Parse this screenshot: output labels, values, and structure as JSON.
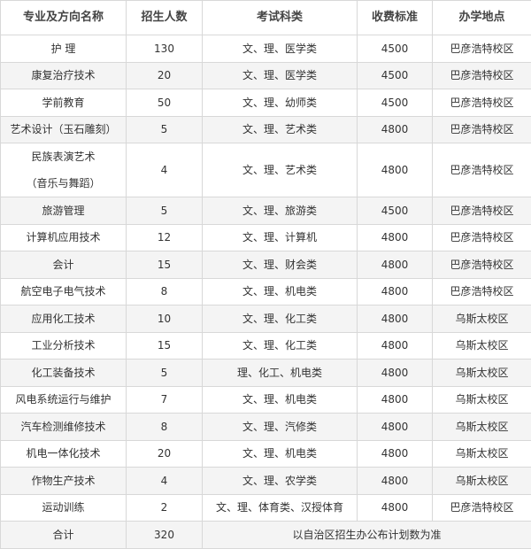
{
  "table": {
    "headers": [
      "专业及方向名称",
      "招生人数",
      "考试科类",
      "收费标准",
      "办学地点"
    ],
    "rows": [
      {
        "major": "护 理",
        "count": "130",
        "subjects": "文、理、医学类",
        "fee": "4500",
        "location": "巴彦浩特校区"
      },
      {
        "major": "康复治疗技术",
        "count": "20",
        "subjects": "文、理、医学类",
        "fee": "4500",
        "location": "巴彦浩特校区"
      },
      {
        "major": "学前教育",
        "count": "50",
        "subjects": "文、理、幼师类",
        "fee": "4500",
        "location": "巴彦浩特校区"
      },
      {
        "major": "艺术设计（玉石雕刻）",
        "count": "5",
        "subjects": "文、理、艺术类",
        "fee": "4800",
        "location": "巴彦浩特校区"
      },
      {
        "major_line1": "民族表演艺术",
        "major_line2": "（音乐与舞蹈）",
        "count": "4",
        "subjects": "文、理、艺术类",
        "fee": "4800",
        "location": "巴彦浩特校区"
      },
      {
        "major": "旅游管理",
        "count": "5",
        "subjects": "文、理、旅游类",
        "fee": "4500",
        "location": "巴彦浩特校区"
      },
      {
        "major": "计算机应用技术",
        "count": "12",
        "subjects": "文、理、计算机",
        "fee": "4800",
        "location": "巴彦浩特校区"
      },
      {
        "major": "会计",
        "count": "15",
        "subjects": "文、理、财会类",
        "fee": "4800",
        "location": "巴彦浩特校区"
      },
      {
        "major": "航空电子电气技术",
        "count": "8",
        "subjects": "文、理、机电类",
        "fee": "4800",
        "location": "巴彦浩特校区"
      },
      {
        "major": "应用化工技术",
        "count": "10",
        "subjects": "文、理、化工类",
        "fee": "4800",
        "location": "乌斯太校区"
      },
      {
        "major": "工业分析技术",
        "count": "15",
        "subjects": "文、理、化工类",
        "fee": "4800",
        "location": "乌斯太校区"
      },
      {
        "major": "化工装备技术",
        "count": "5",
        "subjects": "理、化工、机电类",
        "fee": "4800",
        "location": "乌斯太校区"
      },
      {
        "major": "风电系统运行与维护",
        "count": "7",
        "subjects": "文、理、机电类",
        "fee": "4800",
        "location": "乌斯太校区"
      },
      {
        "major": "汽车检测维修技术",
        "count": "8",
        "subjects": "文、理、汽修类",
        "fee": "4800",
        "location": "乌斯太校区"
      },
      {
        "major": "机电一体化技术",
        "count": "20",
        "subjects": "文、理、机电类",
        "fee": "4800",
        "location": "乌斯太校区"
      },
      {
        "major": "作物生产技术",
        "count": "4",
        "subjects": "文、理、农学类",
        "fee": "4800",
        "location": "乌斯太校区"
      },
      {
        "major": "运动训练",
        "count": "2",
        "subjects": "文、理、体育类、汉授体育",
        "fee": "4800",
        "location": "巴彦浩特校区"
      }
    ],
    "total": {
      "label": "合计",
      "count": "320",
      "note": "以自治区招生办公布计划数为准"
    }
  }
}
